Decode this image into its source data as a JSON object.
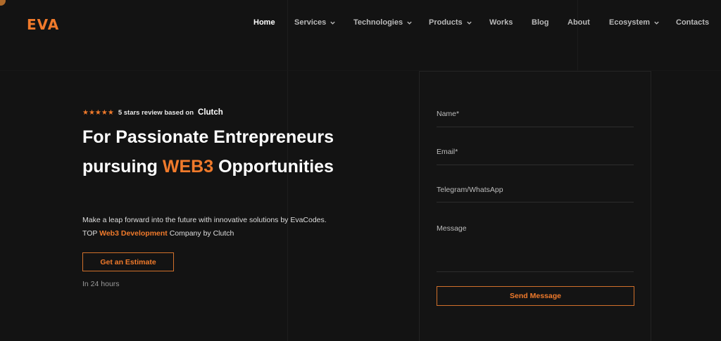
{
  "header": {
    "logo_text": "EVA",
    "nav": [
      {
        "label": "Home",
        "has_dropdown": false
      },
      {
        "label": "Services",
        "has_dropdown": true
      },
      {
        "label": "Technologies",
        "has_dropdown": true
      },
      {
        "label": "Products",
        "has_dropdown": true
      },
      {
        "label": "Works",
        "has_dropdown": false
      },
      {
        "label": "Blog",
        "has_dropdown": false
      },
      {
        "label": "About",
        "has_dropdown": false
      },
      {
        "label": "Ecosystem",
        "has_dropdown": true
      },
      {
        "label": "Contacts",
        "has_dropdown": false
      }
    ]
  },
  "hero": {
    "stars": "★★★★★",
    "rating_text": "5 stars review based on",
    "rating_source": "Clutch",
    "headline_line1": "For Passionate Entrepreneurs",
    "headline_line2_pre": "pursuing ",
    "headline_accent": "WEB3",
    "headline_line2_post": " Opportunities",
    "description_line1": "Make a leap forward into the future with innovative solutions by EvaCodes.",
    "description_line2_pre": "TOP ",
    "description_highlight": "Web3 Development",
    "description_line2_post": " Company by Clutch",
    "cta_label": "Get an Estimate",
    "cta_note": "In 24 hours"
  },
  "form": {
    "name_label": "Name*",
    "email_label": "Email*",
    "telegram_label": "Telegram/WhatsApp",
    "message_label": "Message",
    "submit_label": "Send Message"
  },
  "colors": {
    "accent": "#f07a2b",
    "background": "#131313"
  }
}
